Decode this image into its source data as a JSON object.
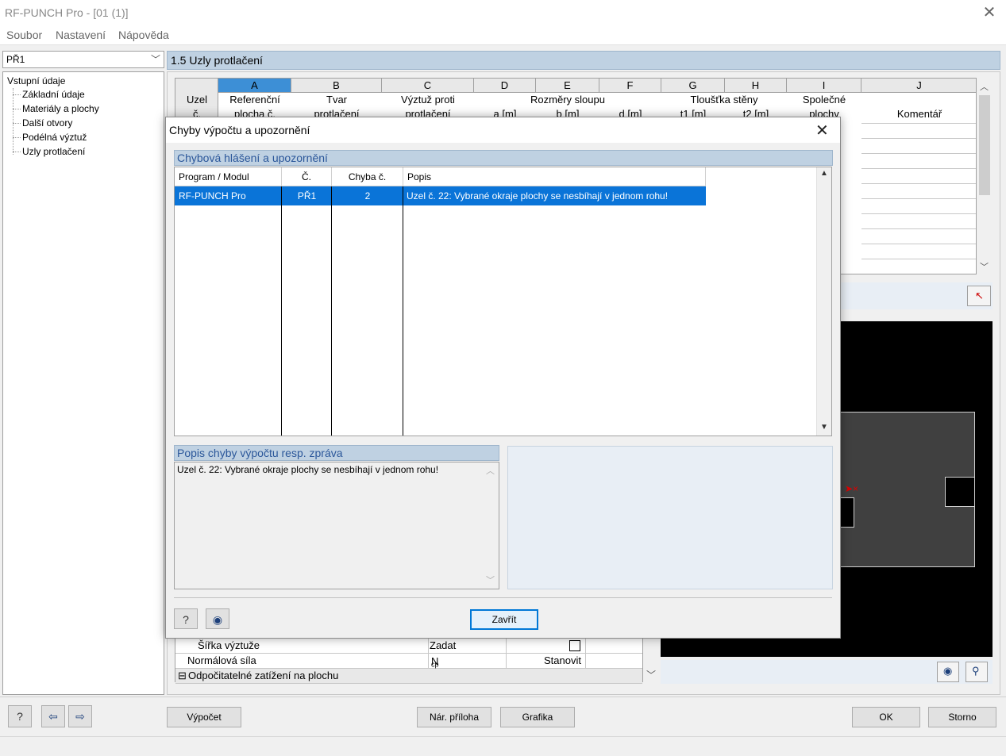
{
  "window": {
    "title": "RF-PUNCH Pro - [01 (1)]"
  },
  "menu": [
    "Soubor",
    "Nastavení",
    "Nápověda"
  ],
  "case_combo": {
    "value": "PŘ1"
  },
  "nav": {
    "root": "Vstupní údaje",
    "items": [
      "Základní údaje",
      "Materiály a plochy",
      "Další otvory",
      "Podélná výztuž",
      "Uzly protlačení"
    ]
  },
  "section": {
    "title": "1.5 Uzly protlačení"
  },
  "table": {
    "corner": [
      "Uzel",
      "č."
    ],
    "columns": [
      "A",
      "B",
      "C",
      "D",
      "E",
      "F",
      "G",
      "H",
      "I",
      "J"
    ],
    "groups": {
      "a": [
        "Referenční",
        "plocha č."
      ],
      "b": [
        "Tvar",
        "protlačení"
      ],
      "c": [
        "Výztuž proti",
        "protlačení"
      ],
      "def": "Rozměry sloupu",
      "d": "a [m]",
      "e": "b [m]",
      "f": "d [m]",
      "gh": "Tloušťka stěny",
      "g": "t1 [m]",
      "h": "t2 [m]",
      "i": [
        "Společné",
        "plochy"
      ],
      "j": "Komentář"
    }
  },
  "bottom_table": {
    "rows": [
      {
        "label": "Šířka výztuže",
        "value": "Zadat",
        "extra": ""
      },
      {
        "label": "Normálová síla",
        "value": "N",
        "sub": "cp",
        "extra": "Stanovit"
      },
      {
        "label": "Odpočitatelné zatížení na plochu",
        "value": "",
        "extra": ""
      }
    ],
    "expander": "⊟"
  },
  "buttons": {
    "vypocet": "Výpočet",
    "nar_priloha": "Nár. příloha",
    "grafika": "Grafika",
    "ok": "OK",
    "storno": "Storno"
  },
  "dialog": {
    "title": "Chyby výpočtu a upozornění",
    "list_section": "Chybová hlášení a upozornění",
    "headers": [
      "Program / Modul",
      "Č.",
      "Chyba č.",
      "Popis"
    ],
    "rows": [
      {
        "program": "RF-PUNCH Pro",
        "case": "PŘ1",
        "error_no": "2",
        "description": "Uzel č. 22: Vybrané okraje plochy se nesbíhají v jednom rohu!"
      }
    ],
    "desc_section": "Popis chyby výpočtu resp. zpráva",
    "desc_text": "Uzel č. 22: Vybrané okraje plochy se nesbíhají v jednom rohu!",
    "close_label": "Zavřít"
  },
  "colors": {
    "selection": "#0a74d8",
    "section_header": "#bfd1e2",
    "column_selected": "#3d8fd6"
  }
}
